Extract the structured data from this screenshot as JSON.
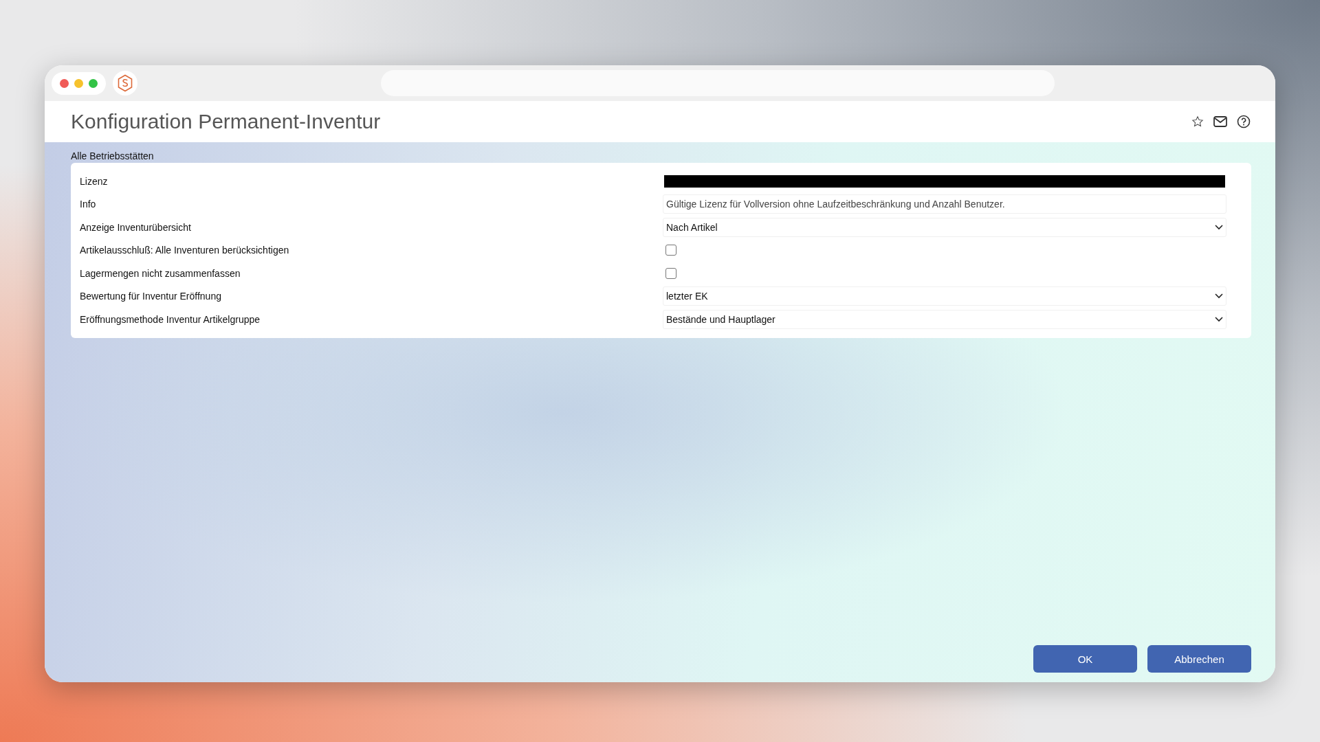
{
  "window": {
    "title": "Konfiguration Permanent-Inventur"
  },
  "section": {
    "label": "Alle Betriebsstätten"
  },
  "rows": [
    {
      "label": "Lizenz",
      "kind": "redacted"
    },
    {
      "label": "Info",
      "kind": "text",
      "value": "Gültige Lizenz für Vollversion ohne Laufzeitbeschränkung und Anzahl Benutzer."
    },
    {
      "label": "Anzeige Inventurübersicht",
      "kind": "select",
      "value": "Nach Artikel"
    },
    {
      "label": "Artikelausschluß: Alle Inventuren berücksichtigen",
      "kind": "checkbox",
      "checked": false
    },
    {
      "label": "Lagermengen nicht zusammenfassen",
      "kind": "checkbox",
      "checked": false
    },
    {
      "label": "Bewertung für Inventur Eröffnung",
      "kind": "select",
      "value": "letzter EK"
    },
    {
      "label": "Eröffnungsmethode Inventur Artikelgruppe",
      "kind": "select",
      "value": "Bestände und Hauptlager"
    }
  ],
  "buttons": [
    "OK",
    "Abbrechen"
  ]
}
